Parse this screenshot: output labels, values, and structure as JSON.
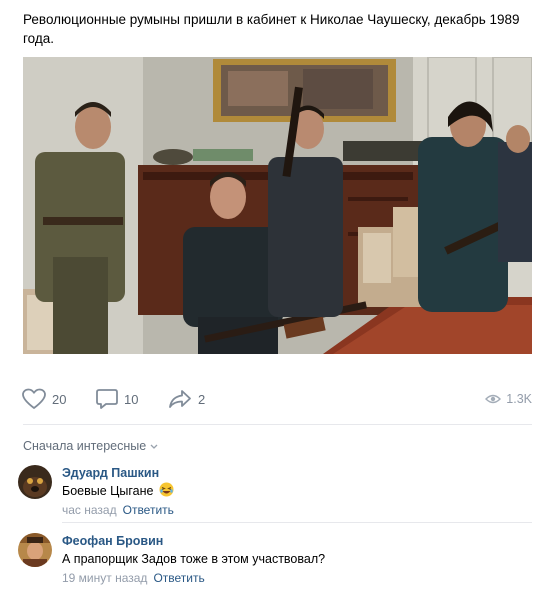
{
  "post": {
    "text": "Революционные румыны пришли в кабинет к Николае Чаушеску, декабрь 1989 года."
  },
  "actions": {
    "likes": "20",
    "comments": "10",
    "shares": "2",
    "views": "1.3K"
  },
  "comments_section": {
    "sort_label": "Сначала интересные"
  },
  "comments": [
    {
      "author": "Эдуард Пашкин",
      "text": "Боевые Цыгане",
      "emoji": "laughing-emoji-icon",
      "time": "час назад",
      "reply_label": "Ответить"
    },
    {
      "author": "Феофан Бровин",
      "text": "А прапорщик Задов тоже в этом участвовал?",
      "time": "19 минут назад",
      "reply_label": "Ответить"
    }
  ],
  "colors": {
    "link": "#2a5885",
    "muted": "#939caa",
    "action": "#626d7a",
    "divider": "#e7e8ec"
  }
}
